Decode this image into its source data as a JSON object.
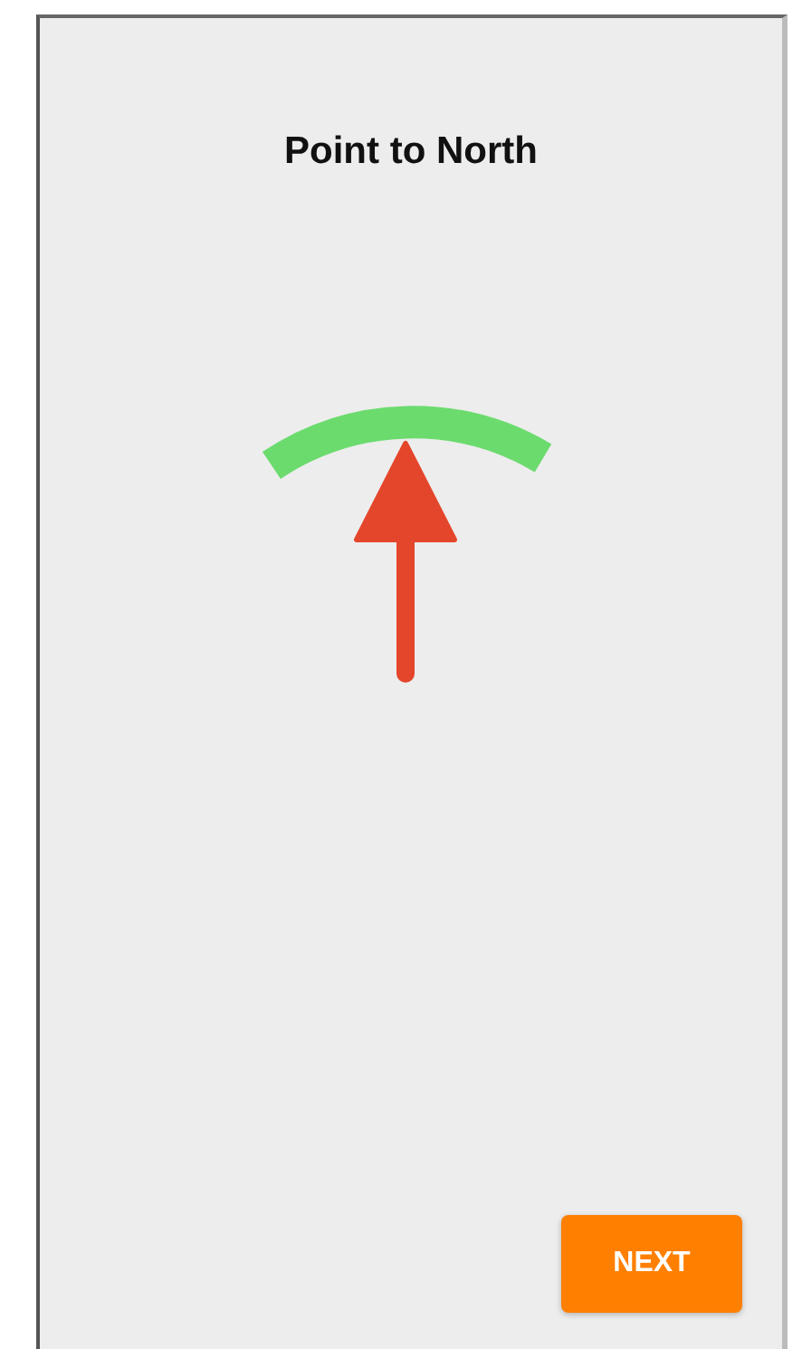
{
  "screen": {
    "title": "Point to North"
  },
  "next_button": {
    "label": "NEXT"
  }
}
